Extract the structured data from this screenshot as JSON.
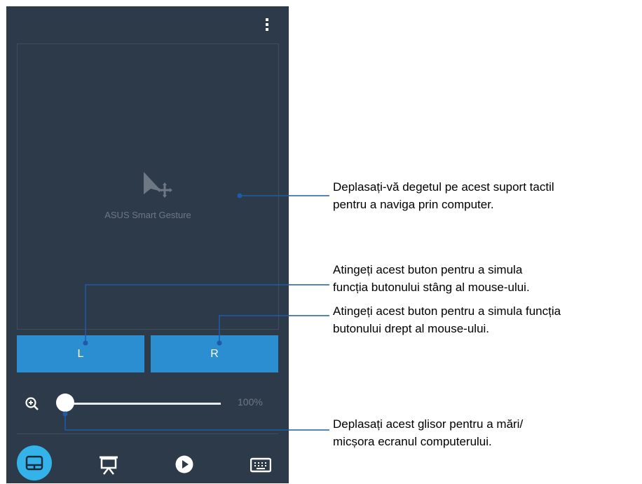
{
  "app": {
    "touchpad_label": "ASUS Smart Gesture",
    "left_button_label": "L",
    "right_button_label": "R",
    "zoom": {
      "value": 0,
      "label": "100%"
    }
  },
  "nav": [
    "touchpad-icon",
    "presentation-icon",
    "play-icon",
    "keyboard-icon"
  ],
  "callouts": {
    "touchpad": [
      "Deplasați-vă degetul pe acest suport tactil",
      "pentru a naviga prin computer."
    ],
    "left_button": [
      "Atingeți acest buton pentru a simula",
      "funcția butonului stâng al mouse-ului."
    ],
    "right_button": [
      "Atingeți acest buton pentru a simula funcția",
      "butonului drept al mouse-ului."
    ],
    "slider": [
      "Deplasați acest glisor pentru a mări/",
      "micșora ecranul computerului."
    ]
  },
  "colors": {
    "panel": "#2c3a4a",
    "button": "#2a8ed1",
    "active_nav": "#34b3ea",
    "callout_line": "#1f5aa6"
  }
}
